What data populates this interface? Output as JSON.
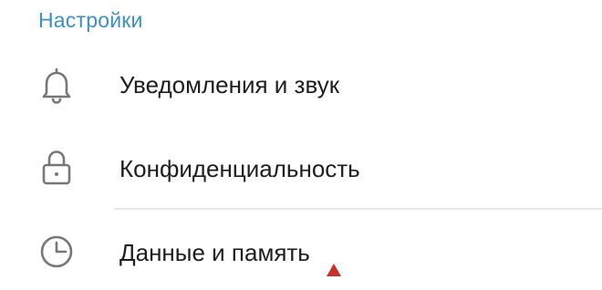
{
  "section": {
    "title": "Настройки",
    "title_color": "#3d8fbf"
  },
  "items": [
    {
      "label": "Уведомления и звук",
      "icon": "bell-icon"
    },
    {
      "label": "Конфиденциальность",
      "icon": "lock-icon"
    },
    {
      "label": "Данные и память",
      "icon": "clock-icon"
    }
  ],
  "colors": {
    "text": "#1e1e1e",
    "icon": "#777777",
    "divider": "#e6e6e6",
    "cursor": "#c8322a"
  }
}
